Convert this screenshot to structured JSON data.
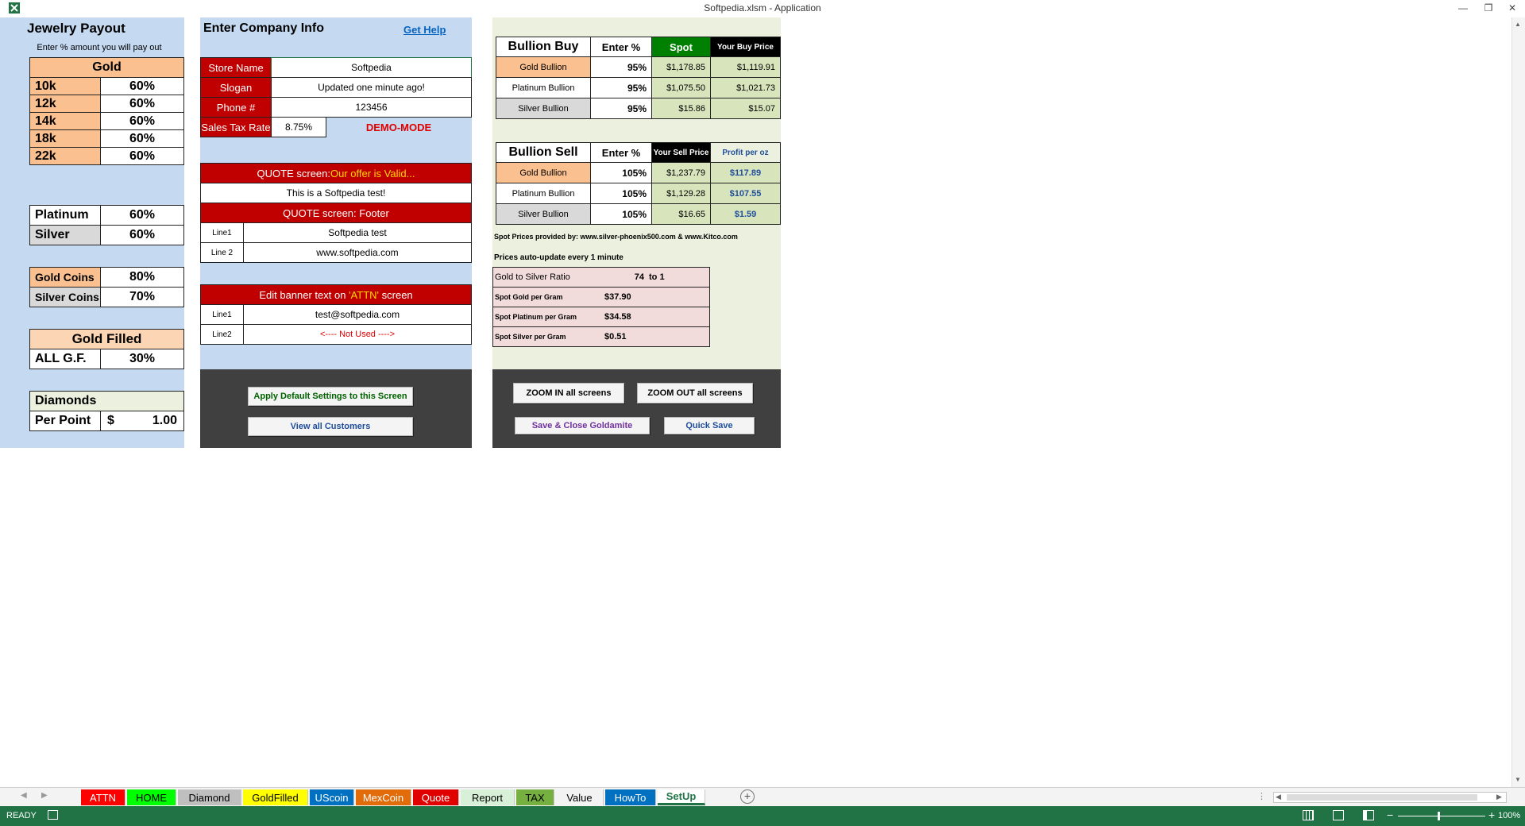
{
  "window": {
    "title": "Softpedia.xlsm - Application",
    "minimize": "—",
    "restore": "❐",
    "close": "✕"
  },
  "jewelry": {
    "title": "Jewelry Payout",
    "subtitle": "Enter % amount you will pay out",
    "gold_header": "Gold",
    "karats": [
      {
        "label": "10k",
        "pct": "60%"
      },
      {
        "label": "12k",
        "pct": "60%"
      },
      {
        "label": "14k",
        "pct": "60%"
      },
      {
        "label": "18k",
        "pct": "60%"
      },
      {
        "label": "22k",
        "pct": "60%"
      }
    ],
    "platinum": {
      "label": "Platinum",
      "pct": "60%"
    },
    "silver": {
      "label": "Silver",
      "pct": "60%"
    },
    "gold_coins": {
      "label": "Gold Coins",
      "pct": "80%"
    },
    "silver_coins": {
      "label": "Silver Coins",
      "pct": "70%"
    },
    "gold_filled_header": "Gold Filled",
    "all_gf": {
      "label": "ALL G.F.",
      "pct": "30%"
    },
    "diamonds_header": "Diamonds",
    "per_point": {
      "label": "Per Point",
      "currency": "$",
      "value": "1.00"
    }
  },
  "company": {
    "title": "Enter Company Info",
    "help": "Get Help",
    "store_name_label": "Store Name",
    "store_name": "Softpedia",
    "slogan_label": "Slogan",
    "slogan": "Updated one minute ago!",
    "phone_label": "Phone #",
    "phone": "123456",
    "tax_label": "Sales Tax Rate",
    "tax": "8.75%",
    "demo": "DEMO-MODE",
    "quote_header_prefix": "QUOTE screen: ",
    "quote_header_highlight": "Our offer is Valid...",
    "quote_text": "This is a Softpedia test!",
    "footer_header": "QUOTE screen: Footer",
    "line1_label": "Line1",
    "line1": "Softpedia test",
    "line2_label": "Line 2",
    "line2": "www.softpedia.com",
    "banner_prefix": "Edit banner text on ",
    "banner_highlight": "'ATTN'",
    "banner_suffix": " screen",
    "banner_line1_label": "Line1",
    "banner_line1": "test@softpedia.com",
    "banner_line2_label": "Line2",
    "banner_line2": "<---- Not Used ---->",
    "apply_btn": "Apply Default Settings to this Screen",
    "customers_btn": "View all Customers"
  },
  "bullion_buy": {
    "title": "Bullion Buy",
    "h_enter": "Enter %",
    "h_spot": "Spot",
    "h_price": "Your Buy Price",
    "rows": [
      {
        "name": "Gold Bullion",
        "pct": "95%",
        "spot": "$1,178.85",
        "price": "$1,119.91"
      },
      {
        "name": "Platinum Bullion",
        "pct": "95%",
        "spot": "$1,075.50",
        "price": "$1,021.73"
      },
      {
        "name": "Silver Bullion",
        "pct": "95%",
        "spot": "$15.86",
        "price": "$15.07"
      }
    ]
  },
  "bullion_sell": {
    "title": "Bullion Sell",
    "h_enter": "Enter %",
    "h_price": "Your Sell Price",
    "h_profit": "Profit per oz",
    "rows": [
      {
        "name": "Gold Bullion",
        "pct": "105%",
        "price": "$1,237.79",
        "profit": "$117.89"
      },
      {
        "name": "Platinum Bullion",
        "pct": "105%",
        "price": "$1,129.28",
        "profit": "$107.55"
      },
      {
        "name": "Silver Bullion",
        "pct": "105%",
        "price": "$16.65",
        "profit": "$1.59"
      }
    ]
  },
  "spot_info": {
    "provided": "Spot Prices provided by: www.silver-phoenix500.com & www.Kitco.com",
    "auto": "Prices auto-update every 1 minute",
    "ratio_label": "Gold to Silver Ratio",
    "ratio_value": "74",
    "ratio_suffix": "to 1",
    "gold_gram_label": "Spot Gold per Gram",
    "gold_gram": "$37.90",
    "plat_gram_label": "Spot Platinum per Gram",
    "plat_gram": "$34.58",
    "silver_gram_label": "Spot Silver per Gram",
    "silver_gram": "$0.51"
  },
  "zoom": {
    "zoom_in": "ZOOM IN all screens",
    "zoom_out": "ZOOM OUT all screens",
    "save_close": "Save & Close Goldamite",
    "quick_save": "Quick Save"
  },
  "tabs": [
    {
      "label": "ATTN",
      "bg": "#ff0000",
      "fg": "#ffffff"
    },
    {
      "label": "HOME",
      "bg": "#00ff00",
      "fg": "#000000"
    },
    {
      "label": "Diamond",
      "bg": "#bfbfbf",
      "fg": "#000000"
    },
    {
      "label": "GoldFilled",
      "bg": "#ffff00",
      "fg": "#000000"
    },
    {
      "label": "UScoin",
      "bg": "#0070c0",
      "fg": "#ffffff"
    },
    {
      "label": "MexCoin",
      "bg": "#e26b0a",
      "fg": "#ffffff"
    },
    {
      "label": "Quote",
      "bg": "#e00000",
      "fg": "#ffffff"
    },
    {
      "label": "Report",
      "bg": "#d8f0d8",
      "fg": "#000000"
    },
    {
      "label": "TAX",
      "bg": "#76b041",
      "fg": "#000000"
    },
    {
      "label": "Value",
      "bg": "#f3f3f3",
      "fg": "#000000"
    },
    {
      "label": "HowTo",
      "bg": "#0070c0",
      "fg": "#ffffff"
    },
    {
      "label": "SetUp",
      "bg": "#ffffff",
      "fg": "#217346"
    }
  ],
  "status": {
    "ready": "READY",
    "zoom": "100%",
    "minus": "−",
    "plus": "+"
  },
  "colors": {
    "excel_green": "#217346",
    "panel_blue": "#c5d9f1",
    "red_header": "#c00000",
    "gold": "#fac090"
  }
}
